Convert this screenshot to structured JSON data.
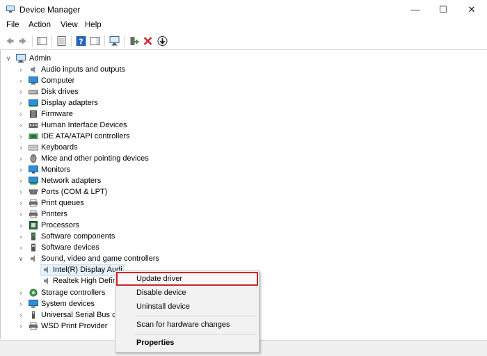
{
  "window": {
    "title": "Device Manager",
    "controls": {
      "minimize": "—",
      "maximize": "☐",
      "close": "✕"
    }
  },
  "menu": [
    "File",
    "Action",
    "View",
    "Help"
  ],
  "toolbar": {
    "buttons": [
      "back-icon",
      "forward-icon",
      "show-hide-console-tree-icon",
      "properties-icon",
      "help-icon",
      "action-pane-icon",
      "scan-hardware-icon",
      "enable-device-icon",
      "uninstall-icon",
      "update-driver-icon"
    ]
  },
  "tree": {
    "root": "Admin",
    "categories": [
      "Audio inputs and outputs",
      "Computer",
      "Disk drives",
      "Display adapters",
      "Firmware",
      "Human Interface Devices",
      "IDE ATA/ATAPI controllers",
      "Keyboards",
      "Mice and other pointing devices",
      "Monitors",
      "Network adapters",
      "Ports (COM & LPT)",
      "Print queues",
      "Printers",
      "Processors",
      "Software components",
      "Software devices",
      "Sound, video and game controllers"
    ],
    "sound_children": [
      "Intel(R) Display Audi",
      "Realtek High Defin"
    ],
    "after": [
      "Storage controllers",
      "System devices",
      "Universal Serial Bus co",
      "WSD Print Provider"
    ]
  },
  "context_menu": {
    "update_driver": "Update driver",
    "disable_device": "Disable device",
    "uninstall_device": "Uninstall device",
    "scan": "Scan for hardware changes",
    "properties": "Properties"
  },
  "colors": {
    "highlight_border": "#d0232b",
    "selection_bg": "#e5f1fb",
    "folder_blue": "#2e6fbf"
  }
}
